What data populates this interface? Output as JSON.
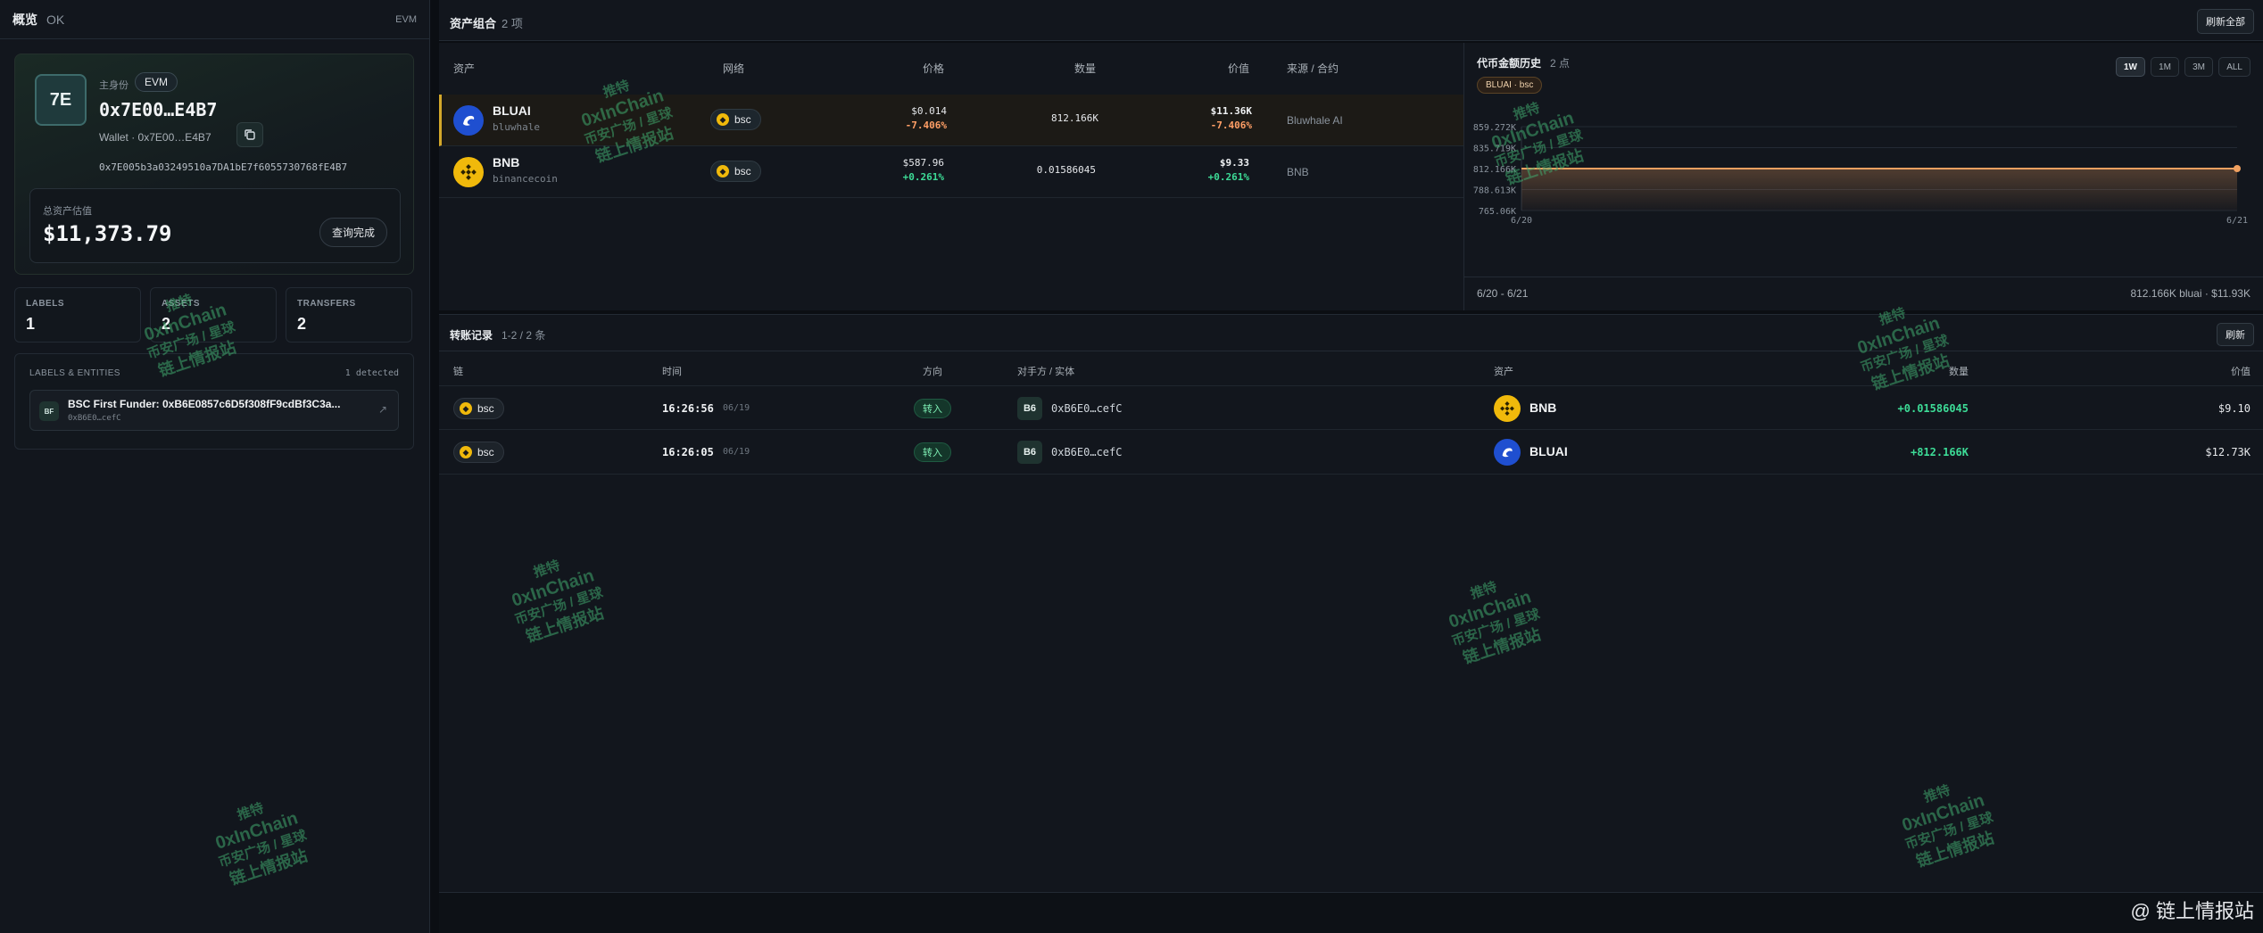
{
  "left": {
    "title": "概览",
    "status": "OK",
    "network": "EVM",
    "avatar_text": "7E",
    "role_label": "主身份",
    "chain_chip": "EVM",
    "address_short": "0x7E00…E4B7",
    "wallet_line": "Wallet · 0x7E00…E4B7",
    "address_full": "0x7E005b3a03249510a7DA1bE7f6055730768fE4B7",
    "total_label": "总资产估值",
    "total_value": "$11,373.79",
    "query_button": "查询完成",
    "stats": [
      {
        "key": "LABELS",
        "value": "1"
      },
      {
        "key": "ASSETS",
        "value": "2"
      },
      {
        "key": "TRANSFERS",
        "value": "2"
      }
    ],
    "labels_title": "LABELS & ENTITIES",
    "labels_detected": "1 detected",
    "entity": {
      "badge": "BF",
      "name": "BSC First Funder: 0xB6E0857c6D5f308fF9cdBf3C3a...",
      "sub": "0xB6E0…cefC"
    }
  },
  "portfolio": {
    "title": "资产组合",
    "count": "2 项",
    "refresh_all": "刷新全部",
    "headers": {
      "asset": "资产",
      "network": "网络",
      "price": "价格",
      "qty": "数量",
      "value": "价值",
      "source": "来源 / 合约"
    },
    "rows": [
      {
        "name": "BLUAI",
        "sub": "bluwhale",
        "network": "bsc",
        "price": "$0.014",
        "price_chg": "-7.406%",
        "qty": "812.166K",
        "value": "$11.36K",
        "value_chg": "-7.406%",
        "source": "Bluwhale AI",
        "icon": "bluwhale-icon"
      },
      {
        "name": "BNB",
        "sub": "binancecoin",
        "network": "bsc",
        "price": "$587.96",
        "price_chg": "+0.261%",
        "qty": "0.01586045",
        "value": "$9.33",
        "value_chg": "+0.261%",
        "source": "BNB",
        "icon": "bnb-icon"
      }
    ]
  },
  "history": {
    "title": "代币金额历史",
    "count": "2 点",
    "chip": "BLUAI · bsc",
    "ranges": [
      "1W",
      "1M",
      "3M",
      "ALL"
    ],
    "active_range": "1W",
    "footer_left": "6/20 - 6/21",
    "footer_right": "812.166K bluai · $11.93K",
    "y_ticks": [
      "859.272K",
      "835.719K",
      "812.166K",
      "788.613K",
      "765.06K"
    ],
    "x_ticks": [
      "6/20",
      "6/21"
    ],
    "accent": "#f0a060"
  },
  "chart_data": {
    "type": "area",
    "title": "代币金额历史",
    "x": [
      "6/20",
      "6/21"
    ],
    "series": [
      {
        "name": "BLUAI · bsc",
        "values": [
          812166,
          812166
        ]
      }
    ],
    "ylim": [
      765060,
      859272
    ],
    "grid": true
  },
  "transfers": {
    "title": "转账记录",
    "count": "1-2 / 2 条",
    "refresh": "刷新",
    "headers": {
      "chain": "链",
      "time": "时间",
      "direction": "方向",
      "counterparty": "对手方 / 实体",
      "asset": "资产",
      "qty": "数量",
      "value": "价值"
    },
    "rows": [
      {
        "chain": "bsc",
        "time": "16:26:56",
        "date": "06/19",
        "direction": "转入",
        "cp_badge": "B6",
        "cp_addr": "0xB6E0…cefC",
        "asset": "BNB",
        "asset_icon": "bnb-icon",
        "qty": "+0.01586045",
        "value": "$9.10"
      },
      {
        "chain": "bsc",
        "time": "16:26:05",
        "date": "06/19",
        "direction": "转入",
        "cp_badge": "B6",
        "cp_addr": "0xB6E0…cefC",
        "asset": "BLUAI",
        "asset_icon": "bluwhale-icon",
        "qty": "+812.166K",
        "value": "$12.73K"
      }
    ]
  },
  "watermark": {
    "line1": "推特",
    "line2": "0xInChain",
    "line3": "币安广场 / 星球",
    "line4": "链上情报站"
  },
  "corner_watermark": "@ 链上情报站"
}
